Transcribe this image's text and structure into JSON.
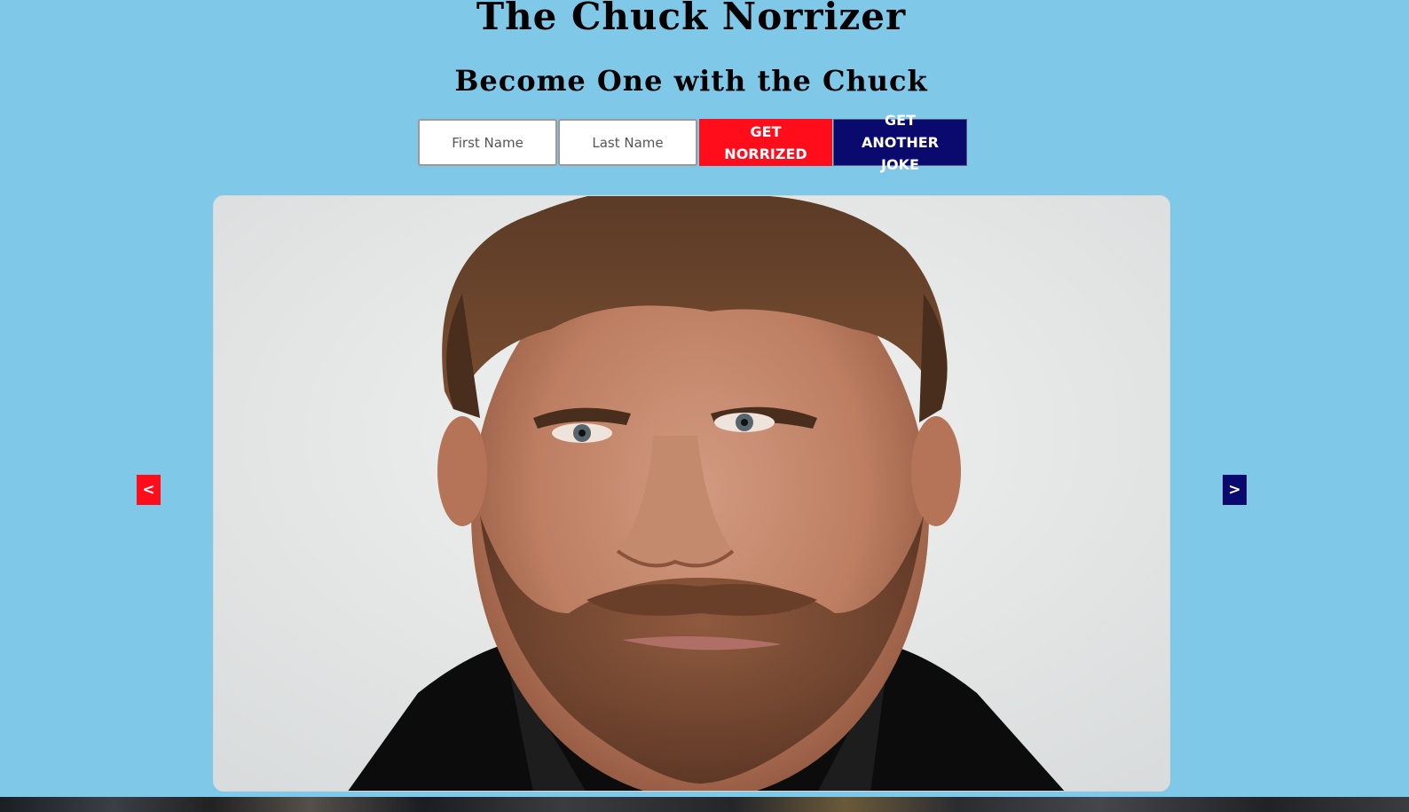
{
  "header": {
    "title": "The Chuck Norrizer",
    "subtitle": "Become One with the Chuck"
  },
  "form": {
    "first_name_placeholder": "First Name",
    "last_name_placeholder": "Last Name",
    "first_name_value": "",
    "last_name_value": "",
    "norrize_label": "GET NORRIZED",
    "another_joke_label": "GET ANOTHER JOKE"
  },
  "carousel": {
    "prev_label": "<",
    "next_label": ">",
    "image_subject": "chuck-norris-portrait"
  },
  "colors": {
    "background": "#80c8e8",
    "accent_red": "#ff0d1a",
    "accent_navy": "#0a0a6e"
  }
}
